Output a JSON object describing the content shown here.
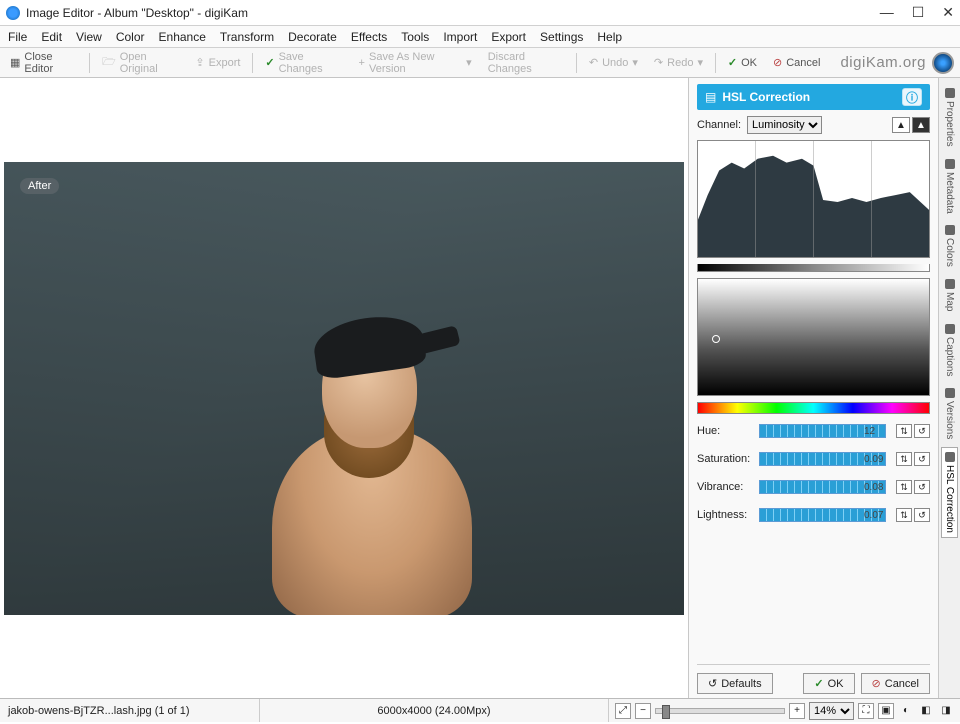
{
  "window": {
    "title": "Image Editor - Album \"Desktop\" - digiKam"
  },
  "menu": [
    "File",
    "Edit",
    "View",
    "Color",
    "Enhance",
    "Transform",
    "Decorate",
    "Effects",
    "Tools",
    "Import",
    "Export",
    "Settings",
    "Help"
  ],
  "toolbar": {
    "close_editor": "Close Editor",
    "open_original": "Open Original",
    "export": "Export",
    "save_changes": "Save Changes",
    "save_as_new": "Save As New Version",
    "discard_changes": "Discard Changes",
    "undo": "Undo",
    "redo": "Redo",
    "ok": "OK",
    "cancel": "Cancel",
    "brand": "digiKam.org"
  },
  "canvas": {
    "after_badge": "After"
  },
  "panel": {
    "title": "HSL Correction",
    "channel_label": "Channel:",
    "channel_value": "Luminosity",
    "sliders": {
      "hue": {
        "label": "Hue:",
        "value": "12"
      },
      "saturation": {
        "label": "Saturation:",
        "value": "0.09"
      },
      "vibrance": {
        "label": "Vibrance:",
        "value": "0.08"
      },
      "lightness": {
        "label": "Lightness:",
        "value": "0.07"
      }
    },
    "footer": {
      "defaults": "Defaults",
      "ok": "OK",
      "cancel": "Cancel"
    }
  },
  "side_tabs": [
    "Properties",
    "Metadata",
    "Colors",
    "Map",
    "Captions",
    "Versions",
    "HSL Correction"
  ],
  "status": {
    "filename": "jakob-owens-BjTZR...lash.jpg (1 of 1)",
    "dimensions": "6000x4000 (24.00Mpx)",
    "zoom_value": "14%"
  }
}
